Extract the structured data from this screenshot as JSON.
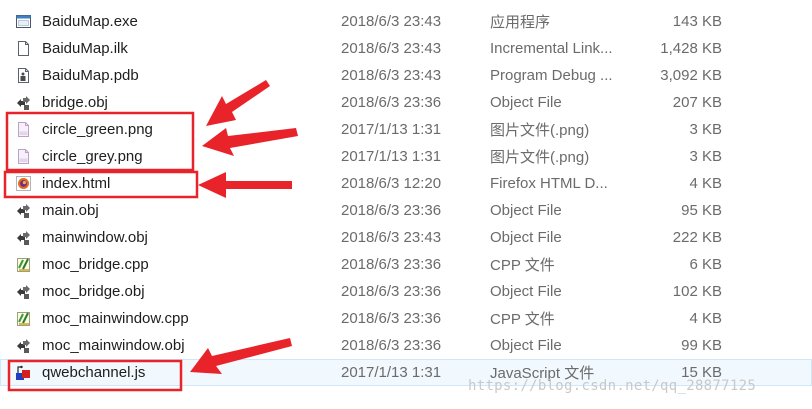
{
  "files": [
    {
      "name": "BaiduMap.exe",
      "date": "2018/6/3 23:43",
      "type": "应用程序",
      "size": "143 KB",
      "icon": "app-window-icon"
    },
    {
      "name": "BaiduMap.ilk",
      "date": "2018/6/3 23:43",
      "type": "Incremental Link...",
      "size": "1,428 KB",
      "icon": "generic-file-icon"
    },
    {
      "name": "BaiduMap.pdb",
      "date": "2018/6/3 23:43",
      "type": "Program Debug ...",
      "size": "3,092 KB",
      "icon": "pdb-file-icon"
    },
    {
      "name": "bridge.obj",
      "date": "2018/6/3 23:36",
      "type": "Object File",
      "size": "207 KB",
      "icon": "obj-file-icon"
    },
    {
      "name": "circle_green.png",
      "date": "2017/1/13 1:31",
      "type": "图片文件(.png)",
      "size": "3 KB",
      "icon": "png-file-icon"
    },
    {
      "name": "circle_grey.png",
      "date": "2017/1/13 1:31",
      "type": "图片文件(.png)",
      "size": "3 KB",
      "icon": "png-file-icon"
    },
    {
      "name": "index.html",
      "date": "2018/6/3 12:20",
      "type": "Firefox HTML D...",
      "size": "4 KB",
      "icon": "firefox-icon"
    },
    {
      "name": "main.obj",
      "date": "2018/6/3 23:36",
      "type": "Object File",
      "size": "95 KB",
      "icon": "obj-file-icon"
    },
    {
      "name": "mainwindow.obj",
      "date": "2018/6/3 23:43",
      "type": "Object File",
      "size": "222 KB",
      "icon": "obj-file-icon"
    },
    {
      "name": "moc_bridge.cpp",
      "date": "2018/6/3 23:36",
      "type": "CPP 文件",
      "size": "6 KB",
      "icon": "cpp-file-icon"
    },
    {
      "name": "moc_bridge.obj",
      "date": "2018/6/3 23:36",
      "type": "Object File",
      "size": "102 KB",
      "icon": "obj-file-icon"
    },
    {
      "name": "moc_mainwindow.cpp",
      "date": "2018/6/3 23:36",
      "type": "CPP 文件",
      "size": "4 KB",
      "icon": "cpp-file-icon"
    },
    {
      "name": "moc_mainwindow.obj",
      "date": "2018/6/3 23:36",
      "type": "Object File",
      "size": "99 KB",
      "icon": "obj-file-icon"
    },
    {
      "name": "qwebchannel.js",
      "date": "2017/1/13 1:31",
      "type": "JavaScript 文件",
      "size": "15 KB",
      "icon": "js-file-icon"
    }
  ],
  "selected_file": "qwebchannel.js",
  "annotation_color": "#e8242a",
  "watermark": "https://blog.csdn.net/qq_28877125"
}
